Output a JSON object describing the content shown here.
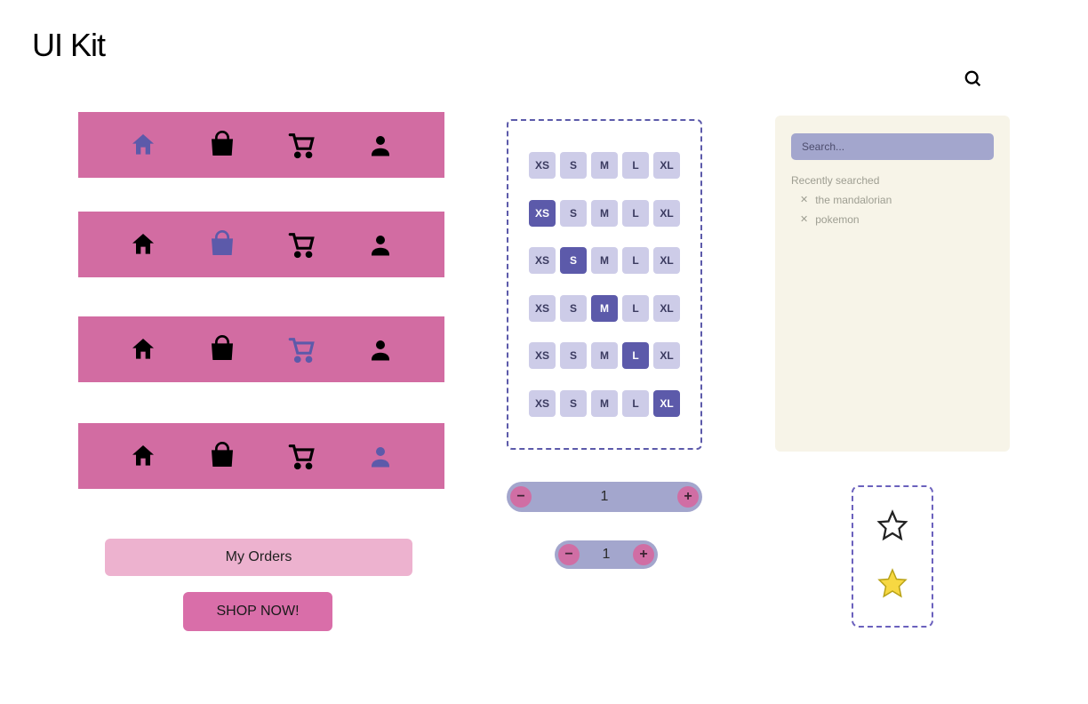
{
  "page": {
    "title": "UI Kit"
  },
  "colors": {
    "pink": "#d26ca2",
    "pinkLight": "#edb2cf",
    "pinkMed": "#d96ea9",
    "lavenderLight": "#cdcce8",
    "lavenderDark": "#5c5aaa",
    "slateLavender": "#a3a6cd",
    "cream": "#f7f4e8",
    "starYellow": "#f7d842"
  },
  "nav": {
    "icons": [
      "home",
      "bag",
      "cart",
      "user"
    ],
    "rows": [
      {
        "active": 0
      },
      {
        "active": 1
      },
      {
        "active": 2
      },
      {
        "active": 3
      }
    ]
  },
  "buttons": {
    "my_orders": "My Orders",
    "shop_now": "SHOP NOW!"
  },
  "sizes": {
    "options": [
      "XS",
      "S",
      "M",
      "L",
      "XL"
    ],
    "rows_selected": [
      -1,
      0,
      1,
      2,
      3,
      4
    ]
  },
  "steppers": {
    "large": {
      "value": "1",
      "minus": "−",
      "plus": "+"
    },
    "small": {
      "value": "1",
      "minus": "−",
      "plus": "+"
    }
  },
  "search": {
    "placeholder": "Search...",
    "recent_title": "Recently searched",
    "recent": [
      {
        "label": "the mandalorian"
      },
      {
        "label": "pokemon"
      }
    ]
  },
  "stars": {
    "outline": true,
    "filled": true
  }
}
